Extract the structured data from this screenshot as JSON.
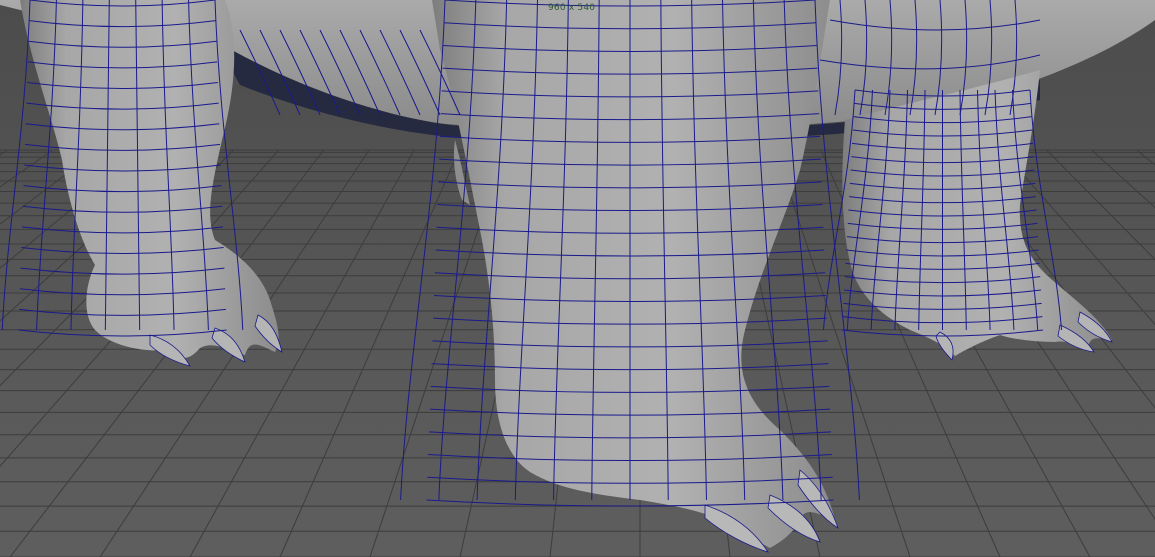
{
  "viewport": {
    "resolution_label": "960 x 540",
    "wire_color": "#1a1a8c",
    "grid_color": "#3a3a3a",
    "background_color": "#5a5a5a",
    "mesh_color": "#a8a8a8"
  }
}
